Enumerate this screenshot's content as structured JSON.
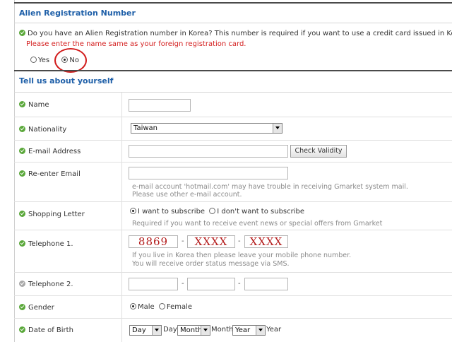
{
  "alien_section": {
    "title": "Alien Registration Number",
    "question": "Do you have an Alien Registration number in Korea? This number is required if you want to use a credit card issued in Korea.",
    "warning": "Please enter the name same as your foreign registration card.",
    "options": [
      {
        "label": "Yes",
        "selected": false
      },
      {
        "label": "No",
        "selected": true
      }
    ]
  },
  "about_section": {
    "title": "Tell us about yourself"
  },
  "fields": {
    "name": {
      "label": "Name",
      "value": ""
    },
    "nationality": {
      "label": "Nationality",
      "value": "Taiwan"
    },
    "email": {
      "label": "E-mail Address",
      "value": "",
      "button": "Check Validity"
    },
    "reemail": {
      "label": "Re-enter Email",
      "value": "",
      "help_line1": "e-mail account 'hotmail.com' may have trouble in receiving Gmarket system mail.",
      "help_line2": "Please use other e-mail account."
    },
    "shopping_letter": {
      "label": "Shopping Letter",
      "options": [
        {
          "label": "I want to subscribe",
          "selected": true
        },
        {
          "label": "I don't want to subscribe",
          "selected": false
        }
      ],
      "help": "Required if you want to receive event news or special offers from Gmarket"
    },
    "telephone1": {
      "label": "Telephone 1.",
      "parts": [
        "8869",
        "XXXX",
        "XXXX"
      ],
      "separator": "-",
      "help_line1": "If you live in Korea then please leave your mobile phone number.",
      "help_line2": "You will receive order status message via SMS."
    },
    "telephone2": {
      "label": "Telephone 2.",
      "parts": [
        "",
        "",
        ""
      ],
      "separator": "-"
    },
    "gender": {
      "label": "Gender",
      "options": [
        {
          "label": "Male",
          "selected": true
        },
        {
          "label": "Female",
          "selected": false
        }
      ]
    },
    "dob": {
      "label": "Date of Birth",
      "day_select": "Day",
      "day_suffix": "Day",
      "month_select": "Month",
      "month_suffix": "Month",
      "year_select": "Year",
      "year_suffix": "Year"
    }
  },
  "colors": {
    "title_blue": "#1e5fa8",
    "warning_red": "#d42020",
    "check_green": "#5aa83a",
    "annotation_circle": "#d21e1e"
  }
}
